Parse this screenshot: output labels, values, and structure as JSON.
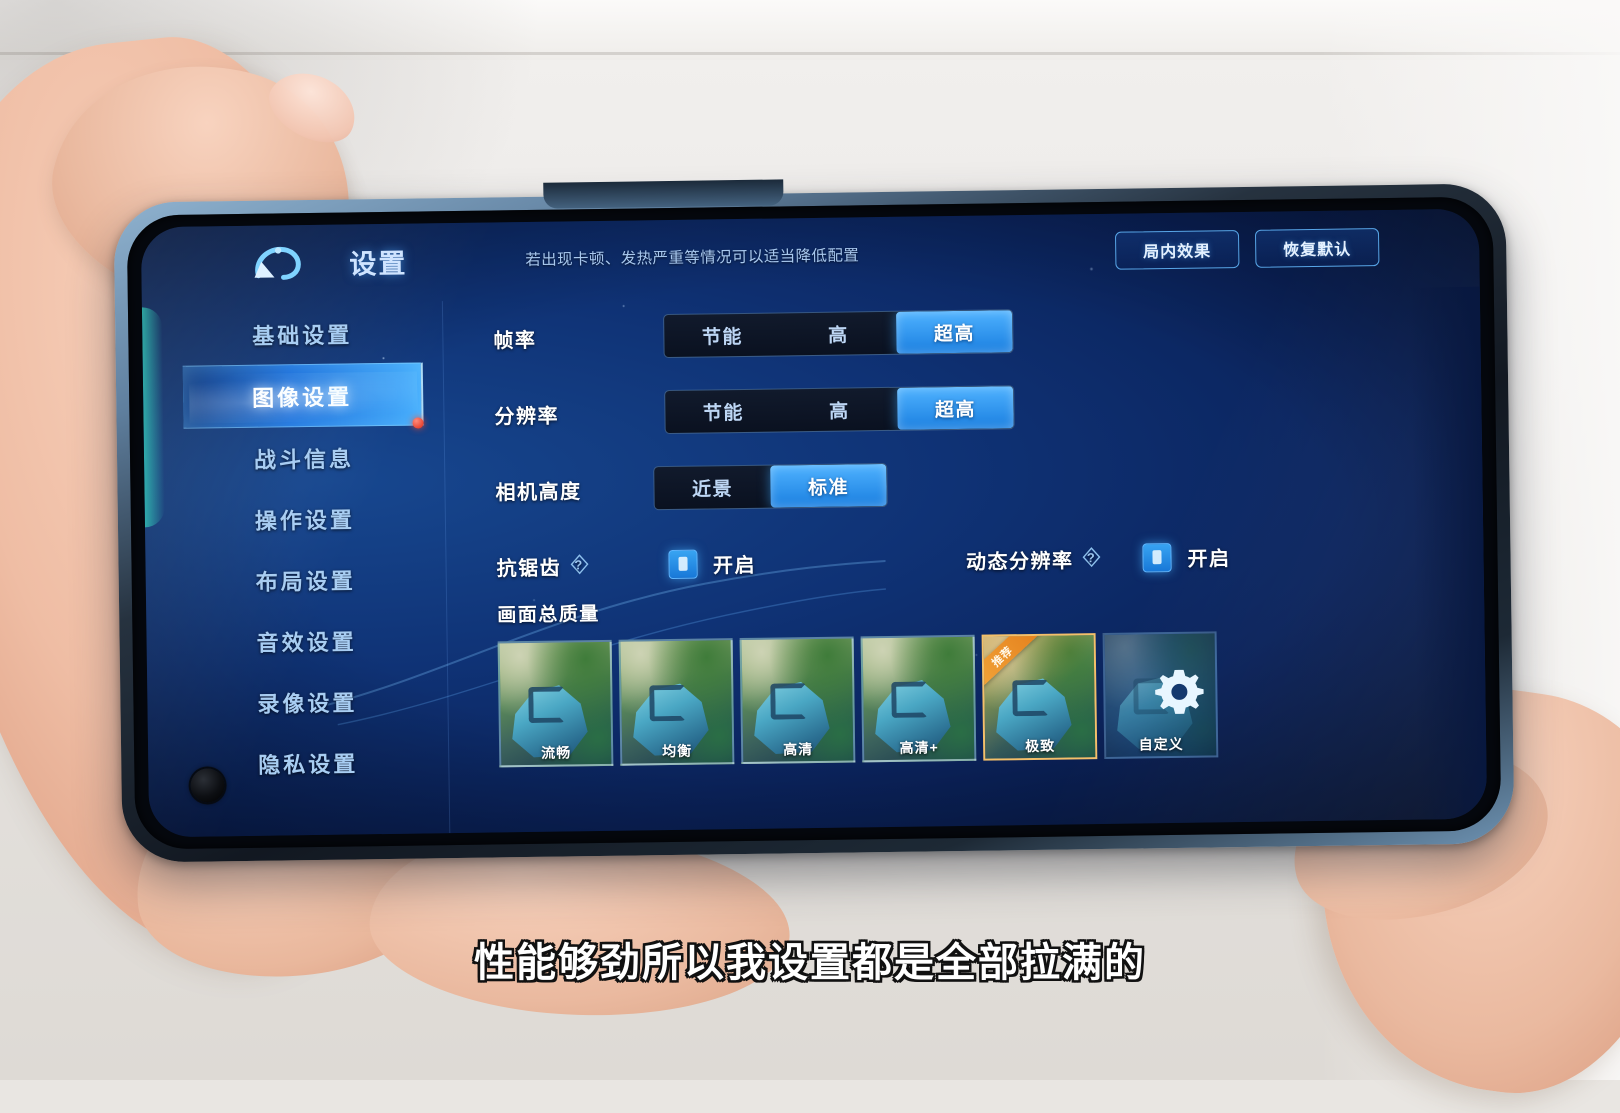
{
  "header": {
    "back_icon": "back-arrow-icon",
    "title": "设置",
    "hint": "若出现卡顿、发热严重等情况可以适当降低配置",
    "actions": [
      {
        "label": "局内效果"
      },
      {
        "label": "恢复默认"
      }
    ]
  },
  "sidebar": {
    "items": [
      {
        "label": "基础设置",
        "active": false
      },
      {
        "label": "图像设置",
        "active": true
      },
      {
        "label": "战斗信息",
        "active": false
      },
      {
        "label": "操作设置",
        "active": false
      },
      {
        "label": "布局设置",
        "active": false
      },
      {
        "label": "音效设置",
        "active": false
      },
      {
        "label": "录像设置",
        "active": false
      },
      {
        "label": "隐私设置",
        "active": false
      }
    ]
  },
  "settings": {
    "frame_rate": {
      "label": "帧率",
      "options": [
        "节能",
        "高",
        "超高"
      ],
      "selected": "超高"
    },
    "resolution": {
      "label": "分辨率",
      "options": [
        "节能",
        "高",
        "超高"
      ],
      "selected": "超高"
    },
    "camera_height": {
      "label": "相机高度",
      "options": [
        "近景",
        "标准"
      ],
      "selected": "标准"
    },
    "anti_aliasing": {
      "label": "抗锯齿",
      "help_icon": "question-mark-icon",
      "state_label": "开启",
      "checked": true
    },
    "dynamic_resolution": {
      "label": "动态分辨率",
      "help_icon": "question-mark-icon",
      "state_label": "开启",
      "checked": true
    },
    "overall_quality": {
      "label": "画面总质量",
      "recommended_badge": "推荐",
      "items": [
        {
          "label": "流畅",
          "recommended": false,
          "custom": false
        },
        {
          "label": "均衡",
          "recommended": false,
          "custom": false
        },
        {
          "label": "高清",
          "recommended": false,
          "custom": false
        },
        {
          "label": "高清+",
          "recommended": false,
          "custom": false
        },
        {
          "label": "极致",
          "recommended": true,
          "custom": false
        },
        {
          "label": "自定义",
          "recommended": false,
          "custom": true
        }
      ]
    }
  },
  "caption": {
    "text": "性能够劲所以我设置都是全部拉满的"
  },
  "colors": {
    "accent": "#3aa7f5",
    "accent_bright": "#4fb2ff",
    "panel_bg": "#0f3275",
    "recommend": "#f3a73c",
    "dot": "#e02a16"
  }
}
